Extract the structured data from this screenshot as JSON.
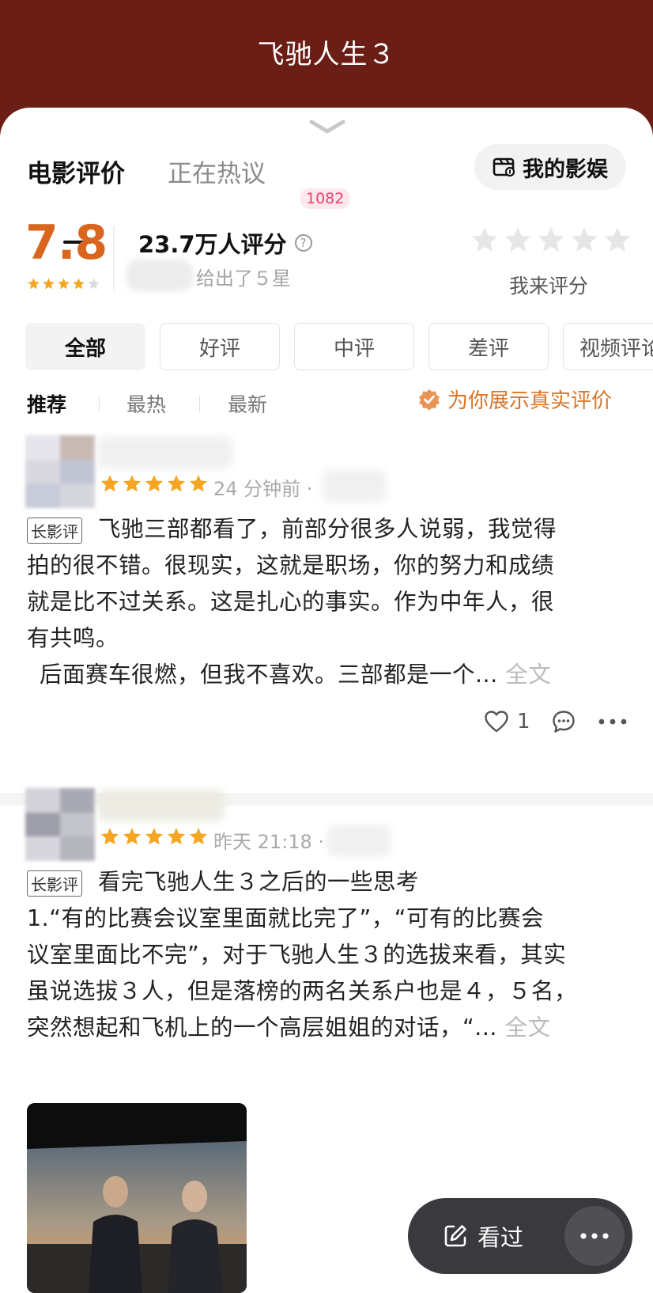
{
  "header": {
    "title": "飞驰人生３"
  },
  "tabs": {
    "active": "电影评价",
    "second": "正在热议",
    "second_badge": "1082"
  },
  "my_entertainment": {
    "label": "我的影娱"
  },
  "rating": {
    "score": "7.8",
    "score_stars": 4,
    "count_text": "23.7万人评分",
    "gave_text": "给出了５星",
    "rate_label": "我来评分"
  },
  "filters": [
    "全部",
    "好评",
    "中评",
    "差评",
    "视频评论"
  ],
  "sort": {
    "items": [
      "推荐",
      "最热",
      "最新"
    ],
    "real_label": "为你展示真实评价"
  },
  "reviews": [
    {
      "stars": 5,
      "time": "24 分钟前 ·",
      "tag": "长影评",
      "line1": "飞驰三部都看了，前部分很多人说弱，我觉得",
      "line2": "拍的很不错。很现实，这就是职场，你的努力和成绩",
      "line3": "就是比不过关系。这是扎心的事实。作为中年人，很",
      "line4": "有共鸣。",
      "line5": "后面赛车很燃，但我不喜欢。三部都是一个...",
      "more": "全文",
      "likes": "1"
    },
    {
      "stars": 5,
      "time": "昨天 21:18 ·",
      "tag": "长影评",
      "title": "看完飞驰人生３之后的一些思考",
      "line1": "1.“有的比赛会议室里面就比完了”，“可有的比赛会",
      "line2": "议室里面比不完”，对于飞驰人生３的选拔来看，其实",
      "line3": "虽说选拔３人，但是落榜的两名关系户也是４，５名，",
      "line4": "突然想起和飞机上的一个高层姐姐的对话，“...",
      "more": "全文"
    }
  ],
  "fab": {
    "watched_label": "看过"
  },
  "colors": {
    "header_bg": "#6b1e16",
    "score": "#d9661f",
    "star": "#f5a623",
    "badge": "#ef3e6a",
    "real": "#d8752a",
    "fab_bg": "#3a3a3e"
  }
}
